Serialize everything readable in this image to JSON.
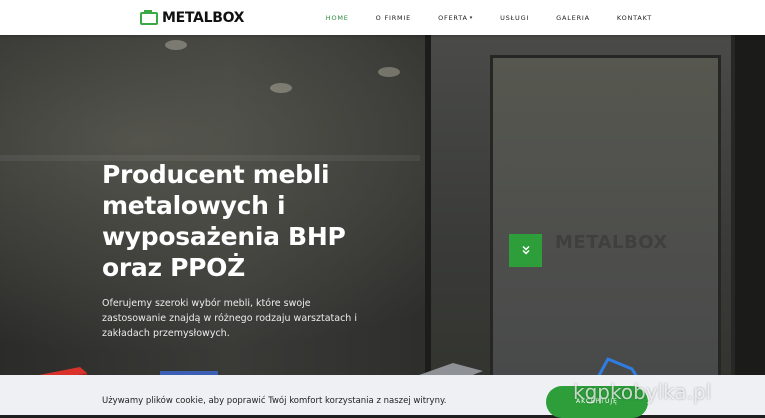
{
  "brand": {
    "name": "METALBOX",
    "accent_color": "#2e9e3b"
  },
  "nav": {
    "items": [
      {
        "label": "HOME",
        "active": true
      },
      {
        "label": "O FIRMIE"
      },
      {
        "label": "OFERTA",
        "has_dropdown": true
      },
      {
        "label": "USŁUGI"
      },
      {
        "label": "GALERIA"
      },
      {
        "label": "KONTAKT"
      }
    ],
    "dropdown_caret": "▾"
  },
  "hero": {
    "title": "Producent mebli metalowych i wyposażenia BHP oraz PPOŻ",
    "description": "Oferujemy szeroki wybór mebli, które swoje zastosowanie znajdą w różnego rodzaju warsztatach i zakładach przemysłowych.",
    "scroll_icon": "double-chevron-down-icon",
    "background_logo": "METALBOX"
  },
  "cookie": {
    "text": "Używamy plików cookie, aby poprawić Twój komfort korzystania z naszej witryny.",
    "accept_label": "AKCEPTUJĘ"
  },
  "watermark": "kgpkobylka.pl"
}
